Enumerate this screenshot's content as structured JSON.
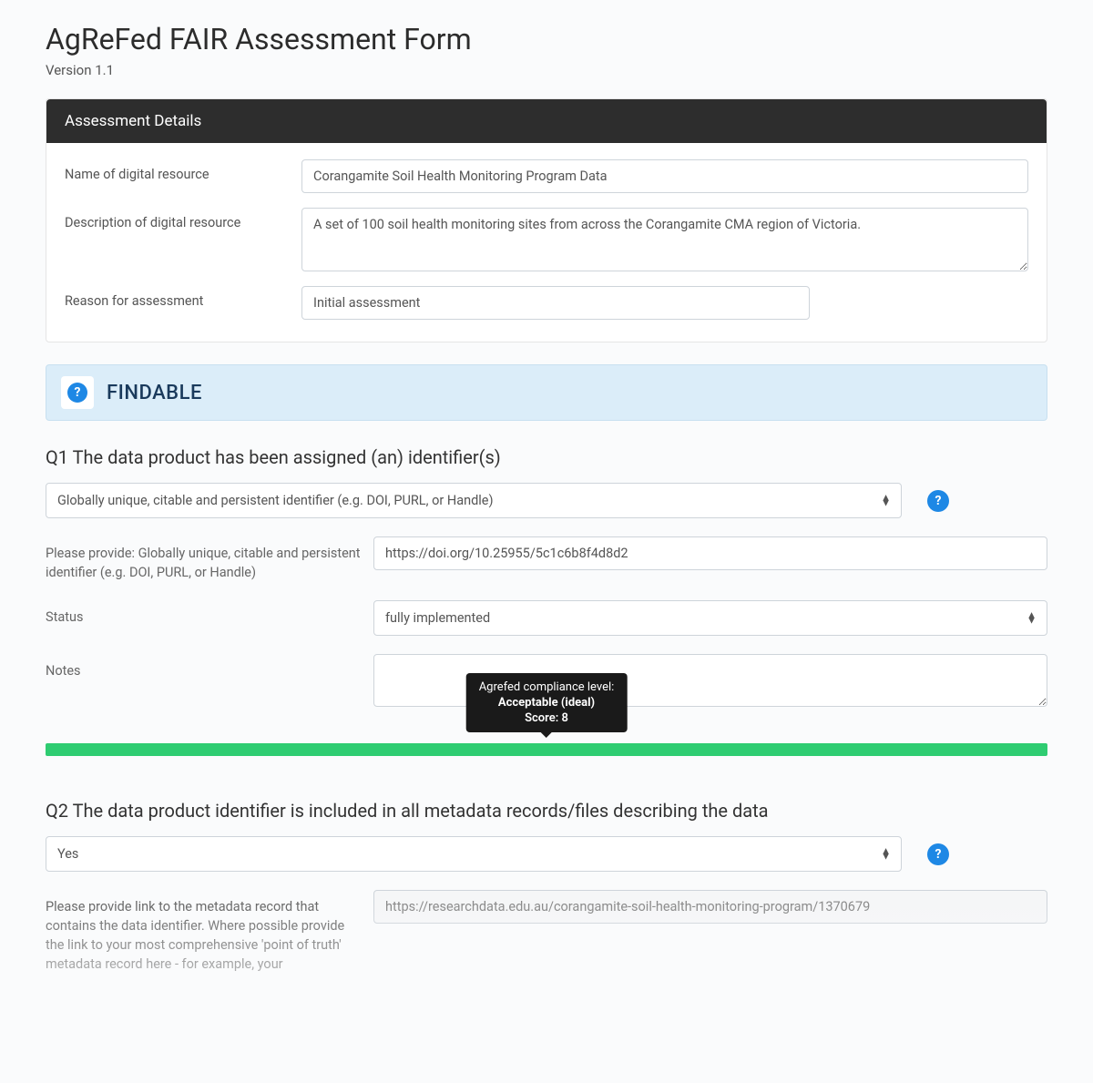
{
  "page": {
    "title": "AgReFed FAIR Assessment Form",
    "version": "Version 1.1"
  },
  "details": {
    "header": "Assessment Details",
    "name_label": "Name of digital resource",
    "name_value": "Corangamite Soil Health Monitoring Program Data",
    "desc_label": "Description of digital resource",
    "desc_value": "A set of 100 soil health monitoring sites from across the Corangamite CMA region of Victoria.",
    "reason_label": "Reason for assessment",
    "reason_value": "Initial assessment"
  },
  "section": {
    "title": "FINDABLE",
    "help": "?"
  },
  "q1": {
    "title": "Q1 The data product has been assigned (an) identifier(s)",
    "select_value": "Globally unique, citable and persistent identifier (e.g. DOI, PURL, or Handle)",
    "help": "?",
    "provide_label": "Please provide: Globally unique, citable and persistent identifier (e.g. DOI, PURL, or Handle)",
    "provide_value": "https://doi.org/10.25955/5c1c6b8f4d8d2",
    "status_label": "Status",
    "status_value": "fully implemented",
    "notes_label": "Notes",
    "notes_value": ""
  },
  "tooltip": {
    "line1": "Agrefed compliance level:",
    "line2": "Acceptable (ideal)",
    "line3": "Score: 8"
  },
  "q2": {
    "title": "Q2 The data product identifier is included in all metadata records/files describing the data",
    "select_value": "Yes",
    "help": "?",
    "provide_label": "Please provide link to the metadata record that contains the data identifier. Where possible provide the link to your most comprehensive 'point of truth' metadata record here - for example, your",
    "provide_value": "https://researchdata.edu.au/corangamite-soil-health-monitoring-program/1370679"
  }
}
